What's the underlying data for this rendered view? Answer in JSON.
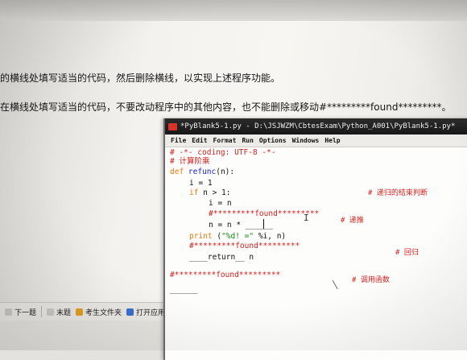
{
  "instructions": {
    "line1": "的横线处填写适当的代码，然后删除横线，以实现上述程序功能。",
    "line2": "在横线处填写适当的代码，不要改动程序中的其他内容，也不能删除或移动#*********found*********。"
  },
  "bottom_toolbar": {
    "items": [
      {
        "label": "下一题",
        "icon": "next-question-icon",
        "color": "#c8c8c8"
      },
      {
        "label": "末题",
        "icon": "last-question-icon",
        "color": "#c8c8c8"
      },
      {
        "label": "考生文件夹",
        "icon": "folder-icon",
        "color": "#e0a020"
      },
      {
        "label": "打开应用",
        "icon": "open-app-icon",
        "color": "#3a6fd0"
      }
    ]
  },
  "idle_window": {
    "title": "*PyBlank5-1.py - D:\\JSJWZM\\CbtesExam\\Python_A001\\PyBlank5-1.py*",
    "menu": [
      "File",
      "Edit",
      "Format",
      "Run",
      "Options",
      "Windows",
      "Help"
    ],
    "code": {
      "l1": "# -*- coding: UTF-8 -*-",
      "l2": "# 计算阶乘",
      "l3_kw": "def",
      "l3_name": " refunc",
      "l3_rest": "(n):",
      "l4": "i = 1",
      "l5_kw": "if",
      "l5_rest": " n > 1:",
      "l6": "i = n",
      "l7": "#*********found*********",
      "l8": "n = n * ______",
      "l9_print": "print",
      "l9_paren": " (",
      "l9_str": "\"%d! =\"",
      "l9_rest": " %i, n)",
      "l10": "#*********found*********",
      "l11": "____return__ n",
      "l12": "#*********found*********",
      "l13": "______"
    },
    "side_comments": {
      "c1": "# 递归的结束判断",
      "c2": "# 递推",
      "c3": "# 回归",
      "c4": "# 调用函数"
    }
  },
  "colors": {
    "comment": "#d42020",
    "keyword": "#e07a10",
    "defname": "#1c1cd0",
    "string": "#198a19"
  }
}
